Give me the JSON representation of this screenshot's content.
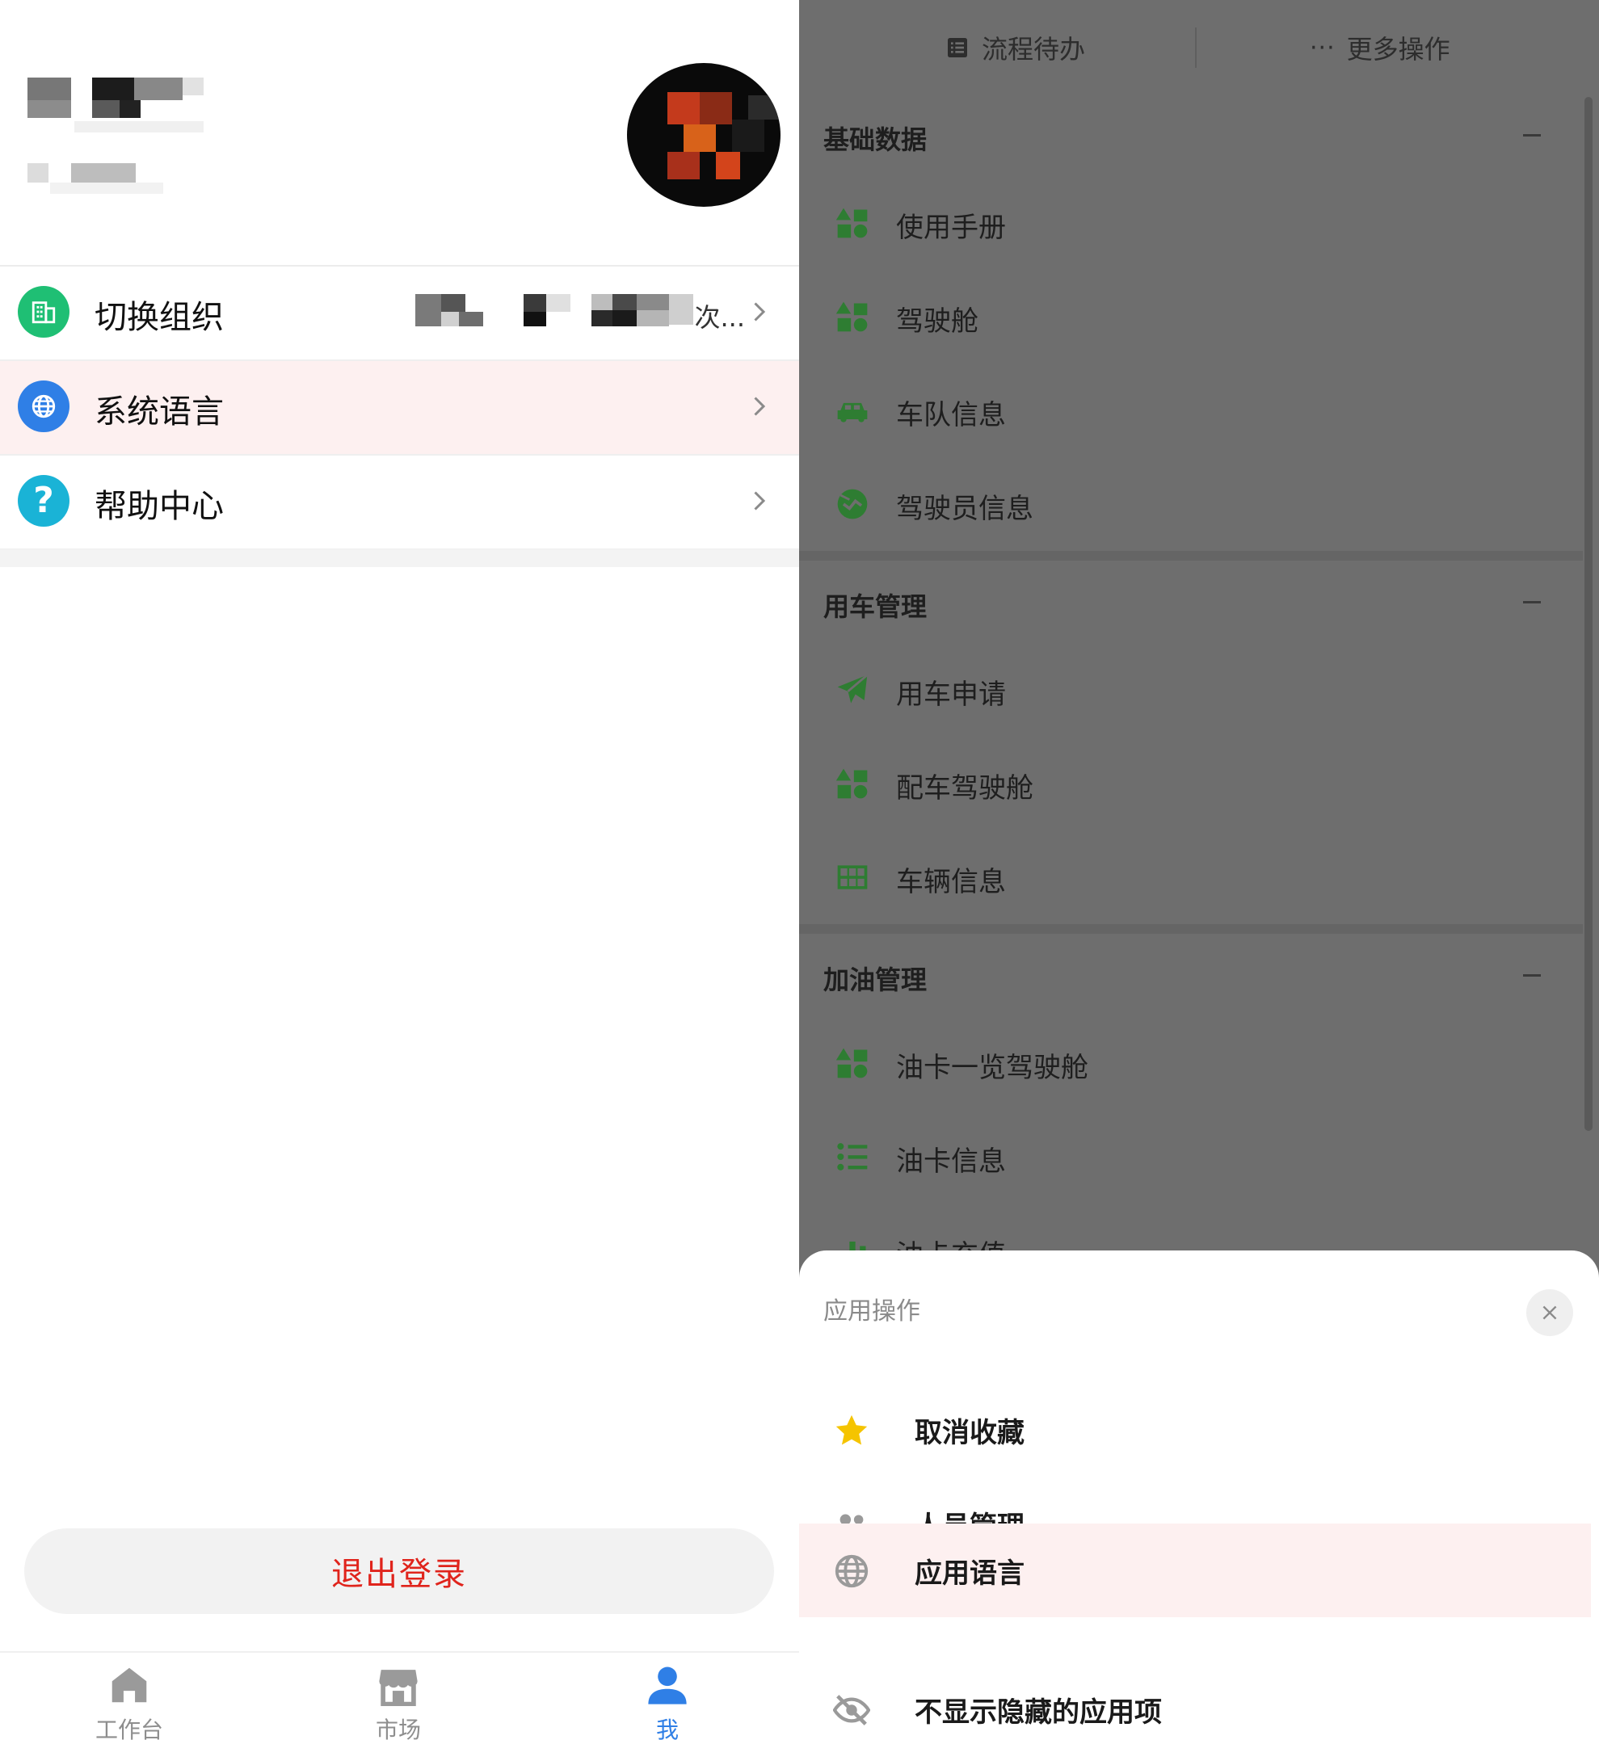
{
  "left_panel": {
    "menu": [
      {
        "label": "切换组织",
        "value": "次...",
        "icon": "building-icon",
        "icon_bg": "#1fbf74"
      },
      {
        "label": "系统语言",
        "value": "",
        "icon": "globe-icon",
        "icon_bg": "#2f7fe6"
      },
      {
        "label": "帮助中心",
        "value": "",
        "icon": "question-icon",
        "icon_bg": "#1ab3d6"
      }
    ],
    "logout_label": "退出登录",
    "tabs": [
      {
        "label": "工作台",
        "icon": "home-icon"
      },
      {
        "label": "市场",
        "icon": "store-icon"
      },
      {
        "label": "我",
        "icon": "person-icon"
      }
    ]
  },
  "right_panel": {
    "topbar": {
      "todo_label": "流程待办",
      "more_label": "更多操作"
    },
    "sections": [
      {
        "title": "基础数据",
        "items": [
          {
            "label": "使用手册",
            "icon": "widgets-icon"
          },
          {
            "label": "驾驶舱",
            "icon": "widgets-icon"
          },
          {
            "label": "车队信息",
            "icon": "car-icon"
          },
          {
            "label": "驾驶员信息",
            "icon": "handshake-icon"
          }
        ]
      },
      {
        "title": "用车管理",
        "items": [
          {
            "label": "用车申请",
            "icon": "paper-plane-icon"
          },
          {
            "label": "配车驾驶舱",
            "icon": "widgets-icon"
          },
          {
            "label": "车辆信息",
            "icon": "table-icon"
          }
        ]
      },
      {
        "title": "加油管理",
        "items": [
          {
            "label": "油卡一览驾驶舱",
            "icon": "widgets-icon"
          },
          {
            "label": "油卡信息",
            "icon": "list-icon"
          },
          {
            "label": "油卡充值",
            "icon": "bar-chart-icon"
          }
        ]
      }
    ],
    "sheet": {
      "title": "应用操作",
      "items": [
        {
          "label": "取消收藏",
          "icon": "star-icon"
        },
        {
          "label": "人员管理",
          "icon": "people-icon"
        },
        {
          "label": "应用语言",
          "icon": "globe-icon"
        },
        {
          "label": "不显示隐藏的应用项",
          "icon": "eye-off-icon"
        }
      ]
    }
  },
  "colors": {
    "accent_blue": "#2f7fe6",
    "logout_red": "#e0241c",
    "icon_green": "#2e7d32",
    "star_yellow": "#f5c400",
    "highlight_pink": "#fdf0f0"
  }
}
